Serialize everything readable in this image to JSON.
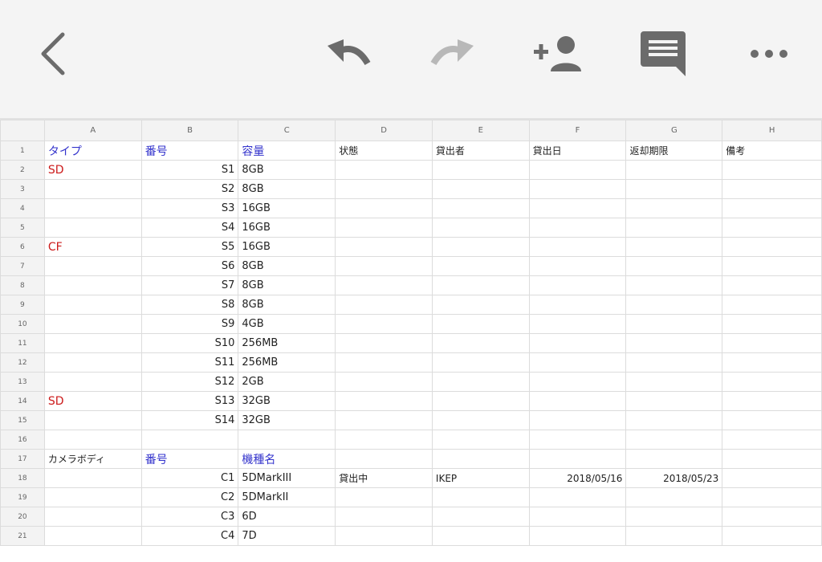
{
  "toolbar": {
    "icons": [
      "back-icon",
      "undo-icon",
      "redo-icon",
      "add-person-icon",
      "comment-icon",
      "more-icon"
    ],
    "colors": {
      "active": "#6b6b6b",
      "disabled": "#b8b8b8",
      "background": "#f4f4f4"
    }
  },
  "sheet": {
    "columns": [
      "A",
      "B",
      "C",
      "D",
      "E",
      "F",
      "G",
      "H"
    ],
    "rows": [
      {
        "num": "1",
        "a": "タイプ",
        "b": "番号",
        "c": "容量",
        "d": "状態",
        "e": "貸出者",
        "f": "貸出日",
        "g": "返却期限",
        "h": "備考"
      },
      {
        "num": "2",
        "a": "SD",
        "b": "S1",
        "c": "8GB",
        "d": "",
        "e": "",
        "f": "",
        "g": "",
        "h": ""
      },
      {
        "num": "3",
        "a": "",
        "b": "S2",
        "c": "8GB",
        "d": "",
        "e": "",
        "f": "",
        "g": "",
        "h": ""
      },
      {
        "num": "4",
        "a": "",
        "b": "S3",
        "c": "16GB",
        "d": "",
        "e": "",
        "f": "",
        "g": "",
        "h": ""
      },
      {
        "num": "5",
        "a": "",
        "b": "S4",
        "c": "16GB",
        "d": "",
        "e": "",
        "f": "",
        "g": "",
        "h": ""
      },
      {
        "num": "6",
        "a": "CF",
        "b": "S5",
        "c": "16GB",
        "d": "",
        "e": "",
        "f": "",
        "g": "",
        "h": ""
      },
      {
        "num": "7",
        "a": "",
        "b": "S6",
        "c": "8GB",
        "d": "",
        "e": "",
        "f": "",
        "g": "",
        "h": ""
      },
      {
        "num": "8",
        "a": "",
        "b": "S7",
        "c": "8GB",
        "d": "",
        "e": "",
        "f": "",
        "g": "",
        "h": ""
      },
      {
        "num": "9",
        "a": "",
        "b": "S8",
        "c": "8GB",
        "d": "",
        "e": "",
        "f": "",
        "g": "",
        "h": ""
      },
      {
        "num": "10",
        "a": "",
        "b": "S9",
        "c": "4GB",
        "d": "",
        "e": "",
        "f": "",
        "g": "",
        "h": ""
      },
      {
        "num": "11",
        "a": "",
        "b": "S10",
        "c": "256MB",
        "d": "",
        "e": "",
        "f": "",
        "g": "",
        "h": ""
      },
      {
        "num": "12",
        "a": "",
        "b": "S11",
        "c": "256MB",
        "d": "",
        "e": "",
        "f": "",
        "g": "",
        "h": ""
      },
      {
        "num": "13",
        "a": "",
        "b": "S12",
        "c": "2GB",
        "d": "",
        "e": "",
        "f": "",
        "g": "",
        "h": ""
      },
      {
        "num": "14",
        "a": "SD",
        "b": "S13",
        "c": "32GB",
        "d": "",
        "e": "",
        "f": "",
        "g": "",
        "h": ""
      },
      {
        "num": "15",
        "a": "",
        "b": "S14",
        "c": "32GB",
        "d": "",
        "e": "",
        "f": "",
        "g": "",
        "h": ""
      },
      {
        "num": "16",
        "a": "",
        "b": "",
        "c": "",
        "d": "",
        "e": "",
        "f": "",
        "g": "",
        "h": ""
      },
      {
        "num": "17",
        "a": "カメラボディ",
        "b": "番号",
        "c": "機種名",
        "d": "",
        "e": "",
        "f": "",
        "g": "",
        "h": ""
      },
      {
        "num": "18",
        "a": "",
        "b": "C1",
        "c": "5DMarkIII",
        "d": "貸出中",
        "e": "IKEP",
        "f": "2018/05/16",
        "g": "2018/05/23",
        "h": ""
      },
      {
        "num": "19",
        "a": "",
        "b": "C2",
        "c": "5DMarkII",
        "d": "",
        "e": "",
        "f": "",
        "g": "",
        "h": ""
      },
      {
        "num": "20",
        "a": "",
        "b": "C3",
        "c": "6D",
        "d": "",
        "e": "",
        "f": "",
        "g": "",
        "h": ""
      },
      {
        "num": "21",
        "a": "",
        "b": "C4",
        "c": "7D",
        "d": "",
        "e": "",
        "f": "",
        "g": "",
        "h": ""
      }
    ]
  }
}
